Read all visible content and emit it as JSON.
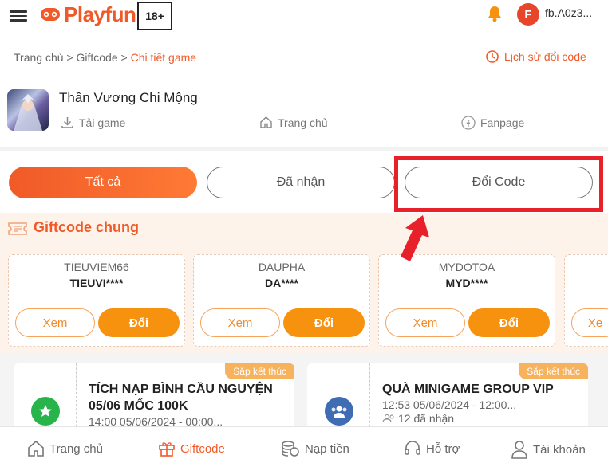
{
  "header": {
    "logo_text": "Playfun",
    "age_rating": "18+",
    "avatar_letter": "F",
    "username": "fb.A0z3..."
  },
  "breadcrumb": {
    "home": "Trang chủ",
    "sep1": ">",
    "giftcode": "Giftcode",
    "sep2": ">",
    "current": "Chi tiết game"
  },
  "history_link": "Lịch sử đổi code",
  "game": {
    "title": "Thần Vương Chi Mộng",
    "links": {
      "download": "Tải game",
      "home": "Trang chủ",
      "fanpage": "Fanpage"
    }
  },
  "tabs": {
    "all": "Tất cả",
    "received": "Đã nhận",
    "redeem": "Đổi Code"
  },
  "section": {
    "title": "Giftcode chung"
  },
  "giftcodes": [
    {
      "name": "TIEUVIEM66",
      "code": "TIEUVI****",
      "view": "Xem",
      "redeem": "Đổi"
    },
    {
      "name": "DAUPHA",
      "code": "DA****",
      "view": "Xem",
      "redeem": "Đổi"
    },
    {
      "name": "MYDOTOA",
      "code": "MYD****",
      "view": "Xem",
      "redeem": "Đổi"
    }
  ],
  "partial_card": {
    "view": "Xe"
  },
  "events": [
    {
      "badge": "Sắp kết thúc",
      "title_line1": "TÍCH NẠP BÌNH CẦU NGUYỆN",
      "title_line2": "05/06 MỐC 100K",
      "time": "14:00 05/06/2024 - 00:00..."
    },
    {
      "badge": "Sắp kết thúc",
      "title_line1": "QUÀ MINIGAME GROUP VIP",
      "time": "12:53 05/06/2024 - 12:00...",
      "received": "12 đã nhận"
    }
  ],
  "bottom_nav": {
    "home": "Trang chủ",
    "giftcode": "Giftcode",
    "topup": "Nạp tiền",
    "support": "Hỗ trợ",
    "account": "Tài khoản"
  },
  "colors": {
    "brand": "#f05a28",
    "accent_orange": "#f7920f",
    "highlight_red": "#e8202a"
  }
}
